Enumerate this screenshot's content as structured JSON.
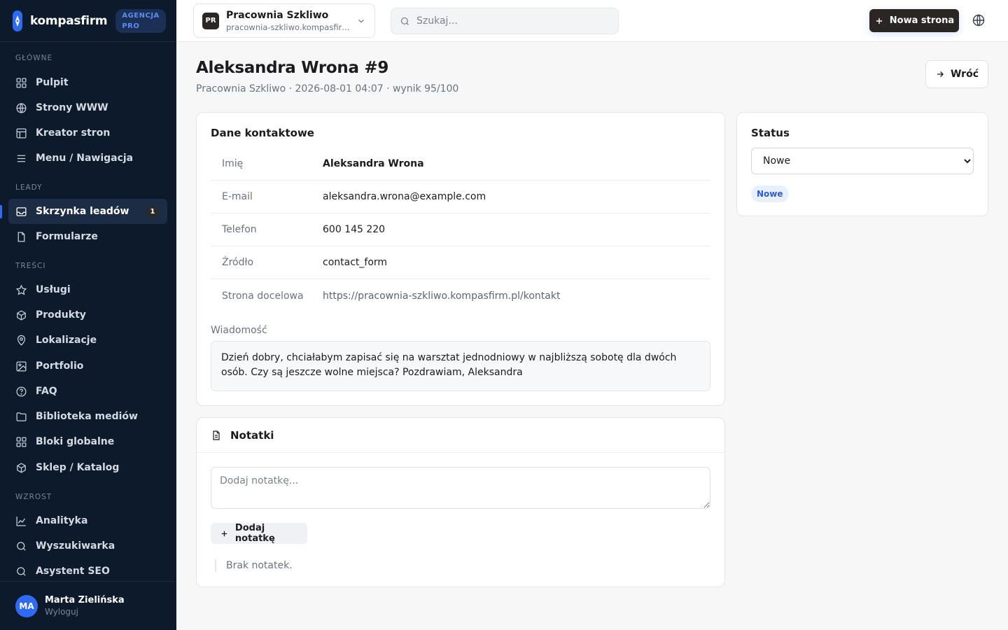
{
  "brand": {
    "name": "kompasfirm",
    "badge_line1": "AGENCJA",
    "badge_line2": "PRO"
  },
  "sidebar": {
    "sections": [
      {
        "label": "GŁÓWNE"
      },
      {
        "label": "LEADY"
      },
      {
        "label": "TREŚCI"
      },
      {
        "label": "WZROST"
      }
    ],
    "items": [
      {
        "label": "Pulpit",
        "icon": "grid-icon"
      },
      {
        "label": "Strony WWW",
        "icon": "globe-icon"
      },
      {
        "label": "Kreator stron",
        "icon": "layout-icon"
      },
      {
        "label": "Menu / Nawigacja",
        "icon": "menu-icon"
      },
      {
        "label": "Skrzynka leadów",
        "icon": "inbox-icon",
        "badge": "1",
        "active": true
      },
      {
        "label": "Formularze",
        "icon": "file-icon"
      },
      {
        "label": "Usługi",
        "icon": "star-icon"
      },
      {
        "label": "Produkty",
        "icon": "box-icon"
      },
      {
        "label": "Lokalizacje",
        "icon": "map-pin-icon"
      },
      {
        "label": "Portfolio",
        "icon": "image-icon"
      },
      {
        "label": "FAQ",
        "icon": "help-circle-icon"
      },
      {
        "label": "Biblioteka mediów",
        "icon": "folder-icon"
      },
      {
        "label": "Bloki globalne",
        "icon": "grid-icon"
      },
      {
        "label": "Sklep / Katalog",
        "icon": "box-icon"
      },
      {
        "label": "Analityka",
        "icon": "chart-icon"
      },
      {
        "label": "Wyszukiwarka",
        "icon": "search-icon"
      },
      {
        "label": "Asystent SEO",
        "icon": "search-icon"
      }
    ]
  },
  "user": {
    "initials": "MA",
    "name": "Marta Zielińska",
    "logout_label": "Wyloguj"
  },
  "topbar": {
    "site_initials": "PR",
    "site_name": "Pracownia Szkliwo",
    "site_url": "pracownia-szkliwo.kompasfirm.pl",
    "search_placeholder": "Szukaj...",
    "new_page_label": "Nowa strona"
  },
  "page": {
    "title": "Aleksandra Wrona #9",
    "subtitle": "Pracownia Szkliwo · 2026-08-01 04:07 · wynik 95/100",
    "back_label": "Wróć"
  },
  "contact": {
    "title": "Dane kontaktowe",
    "rows": [
      {
        "key": "Imię",
        "value": "Aleksandra Wrona"
      },
      {
        "key": "E-mail",
        "value": "aleksandra.wrona@example.com"
      },
      {
        "key": "Telefon",
        "value": "600 145 220"
      },
      {
        "key": "Źródło",
        "value": "contact_form"
      },
      {
        "key": "Strona docelowa",
        "value": "https://pracownia-szkliwo.kompasfirm.pl/kontakt"
      }
    ],
    "message_label": "Wiadomość",
    "message": "Dzień dobry, chciałabym zapisać się na warsztat jednodniowy w najbliższą sobotę dla dwóch osób. Czy są jeszcze wolne miejsca? Pozdrawiam, Aleksandra"
  },
  "notes": {
    "title": "Notatki",
    "placeholder": "Dodaj notatkę...",
    "add_label": "Dodaj notatkę",
    "empty_text": "Brak notatek."
  },
  "status": {
    "title": "Status",
    "selected": "Nowe",
    "badge": "Nowe"
  },
  "colors": {
    "sidebar_bg": "#0c1a2b",
    "accent": "#2f6bf2",
    "primary_button": "#2a2623",
    "status_badge_bg": "#e8f0fd",
    "status_badge_text": "#2f5bd0"
  }
}
